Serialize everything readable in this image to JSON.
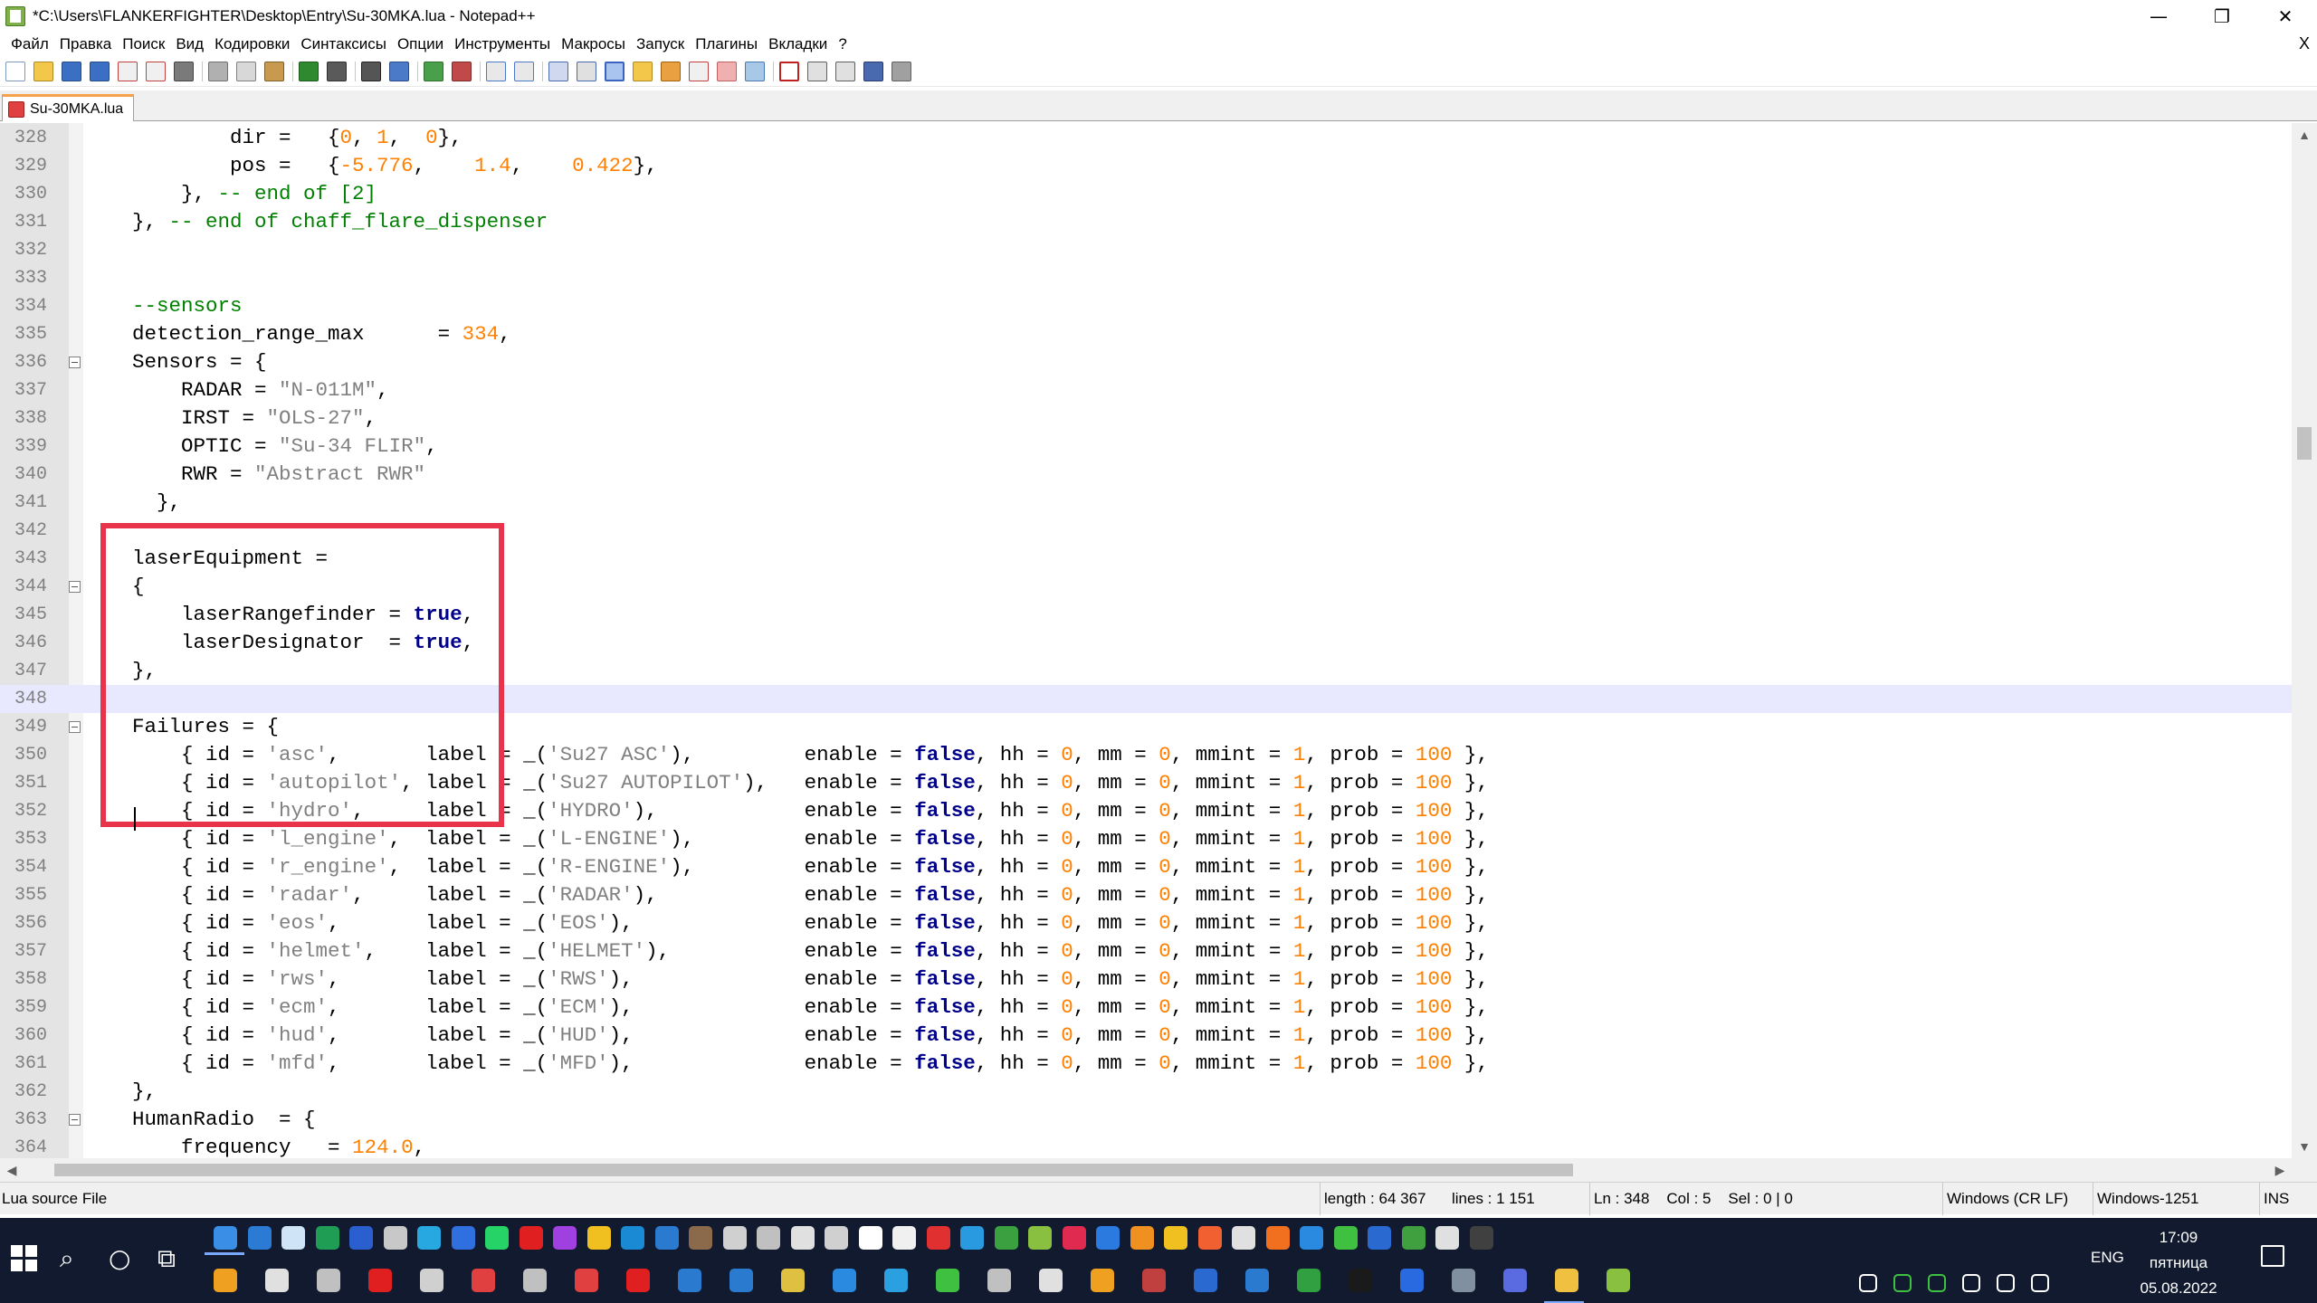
{
  "window": {
    "title": "*C:\\Users\\FLANKERFIGHTER\\Desktop\\Entry\\Su-30MKA.lua - Notepad++",
    "minimize": "—",
    "maximize": "❐",
    "close": "✕"
  },
  "menu": {
    "items": [
      "Файл",
      "Правка",
      "Поиск",
      "Вид",
      "Кодировки",
      "Синтаксисы",
      "Опции",
      "Инструменты",
      "Макросы",
      "Запуск",
      "Плагины",
      "Вкладки",
      "?"
    ],
    "close_doc": "X"
  },
  "tab": {
    "label": "Su-30MKA.lua"
  },
  "editor": {
    "current_line": "348",
    "lines": [
      {
        "n": "328",
        "fold": "",
        "code": "            dir =   {0, 1,  0},"
      },
      {
        "n": "329",
        "fold": "",
        "code": "            pos =   {-5.776,    1.4,    0.422},"
      },
      {
        "n": "330",
        "fold": "",
        "code": "        }, -- end of [2]"
      },
      {
        "n": "331",
        "fold": "",
        "code": "    }, -- end of chaff_flare_dispenser"
      },
      {
        "n": "332",
        "fold": "",
        "code": ""
      },
      {
        "n": "333",
        "fold": "",
        "code": ""
      },
      {
        "n": "334",
        "fold": "",
        "code": "    --sensors"
      },
      {
        "n": "335",
        "fold": "",
        "code": "    detection_range_max      = 334,"
      },
      {
        "n": "336",
        "fold": "box",
        "code": "    Sensors = {"
      },
      {
        "n": "337",
        "fold": "",
        "code": "        RADAR = \"N-011M\","
      },
      {
        "n": "338",
        "fold": "",
        "code": "        IRST = \"OLS-27\","
      },
      {
        "n": "339",
        "fold": "",
        "code": "        OPTIC = \"Su-34 FLIR\","
      },
      {
        "n": "340",
        "fold": "",
        "code": "        RWR = \"Abstract RWR\""
      },
      {
        "n": "341",
        "fold": "",
        "code": "      },"
      },
      {
        "n": "342",
        "fold": "",
        "code": ""
      },
      {
        "n": "343",
        "fold": "",
        "code": "    laserEquipment ="
      },
      {
        "n": "344",
        "fold": "box",
        "code": "    {"
      },
      {
        "n": "345",
        "fold": "",
        "code": "        laserRangefinder = true,"
      },
      {
        "n": "346",
        "fold": "",
        "code": "        laserDesignator  = true,"
      },
      {
        "n": "347",
        "fold": "",
        "code": "    },"
      },
      {
        "n": "348",
        "fold": "",
        "code": ""
      },
      {
        "n": "349",
        "fold": "box",
        "code": "    Failures = {"
      },
      {
        "n": "350",
        "fold": "",
        "code": "        { id = 'asc',       label = _('Su27 ASC'),         enable = false, hh = 0, mm = 0, mmint = 1, prob = 100 },"
      },
      {
        "n": "351",
        "fold": "",
        "code": "        { id = 'autopilot', label = _('Su27 AUTOPILOT'),   enable = false, hh = 0, mm = 0, mmint = 1, prob = 100 },"
      },
      {
        "n": "352",
        "fold": "",
        "code": "        { id = 'hydro',     label = _('HYDRO'),            enable = false, hh = 0, mm = 0, mmint = 1, prob = 100 },"
      },
      {
        "n": "353",
        "fold": "",
        "code": "        { id = 'l_engine',  label = _('L-ENGINE'),         enable = false, hh = 0, mm = 0, mmint = 1, prob = 100 },"
      },
      {
        "n": "354",
        "fold": "",
        "code": "        { id = 'r_engine',  label = _('R-ENGINE'),         enable = false, hh = 0, mm = 0, mmint = 1, prob = 100 },"
      },
      {
        "n": "355",
        "fold": "",
        "code": "        { id = 'radar',     label = _('RADAR'),            enable = false, hh = 0, mm = 0, mmint = 1, prob = 100 },"
      },
      {
        "n": "356",
        "fold": "",
        "code": "        { id = 'eos',       label = _('EOS'),              enable = false, hh = 0, mm = 0, mmint = 1, prob = 100 },"
      },
      {
        "n": "357",
        "fold": "",
        "code": "        { id = 'helmet',    label = _('HELMET'),           enable = false, hh = 0, mm = 0, mmint = 1, prob = 100 },"
      },
      {
        "n": "358",
        "fold": "",
        "code": "        { id = 'rws',       label = _('RWS'),              enable = false, hh = 0, mm = 0, mmint = 1, prob = 100 },"
      },
      {
        "n": "359",
        "fold": "",
        "code": "        { id = 'ecm',       label = _('ECM'),              enable = false, hh = 0, mm = 0, mmint = 1, prob = 100 },"
      },
      {
        "n": "360",
        "fold": "",
        "code": "        { id = 'hud',       label = _('HUD'),              enable = false, hh = 0, mm = 0, mmint = 1, prob = 100 },"
      },
      {
        "n": "361",
        "fold": "",
        "code": "        { id = 'mfd',       label = _('MFD'),              enable = false, hh = 0, mm = 0, mmint = 1, prob = 100 },"
      },
      {
        "n": "362",
        "fold": "",
        "code": "    },"
      },
      {
        "n": "363",
        "fold": "box",
        "code": "    HumanRadio  = {"
      },
      {
        "n": "364",
        "fold": "",
        "code": "        frequency   = 124.0,"
      }
    ]
  },
  "status": {
    "file_type": "Lua source File",
    "length": "length : 64 367",
    "lines": "lines : 1 151",
    "position": "Ln : 348    Col : 5    Sel : 0 | 0",
    "eol": "Windows (CR LF)",
    "encoding": "Windows-1251",
    "mode": "INS"
  },
  "taskbar": {
    "language": "ENG",
    "time": "17:09",
    "weekday": "пятница",
    "date": "05.08.2022"
  },
  "colors": {
    "comment": "#008000",
    "number": "#ff8000",
    "string": "#808080",
    "keyword": "#00008b",
    "highlight_box": "#e8334a",
    "taskbar": "#111a2e"
  }
}
